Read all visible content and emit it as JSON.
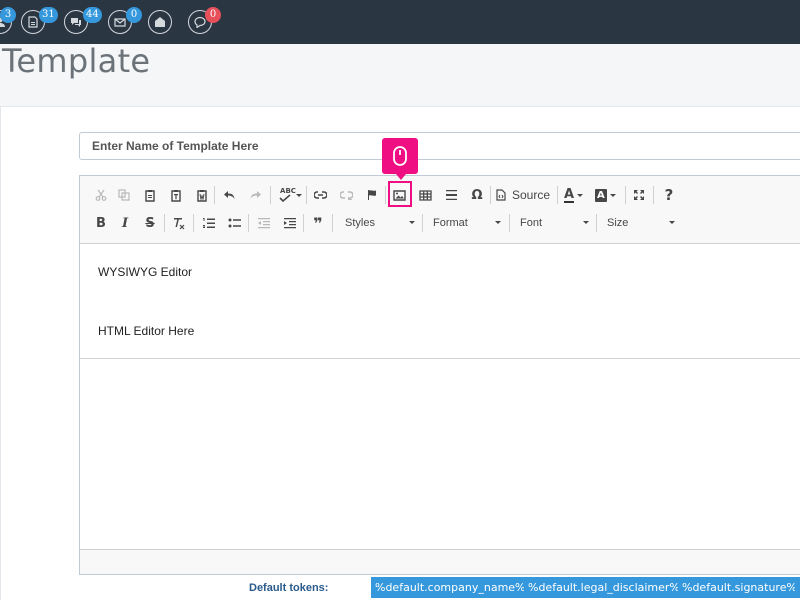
{
  "colors": {
    "topbar": "#2b3643",
    "badge_blue": "#3598dc",
    "badge_red": "#e7505a",
    "highlight": "#ef0f83",
    "token_bg": "#3598dc"
  },
  "topbar": {
    "items": [
      {
        "icon": "user-icon",
        "badge": "3"
      },
      {
        "icon": "document-icon",
        "badge": "31"
      },
      {
        "icon": "chat-icon",
        "badge": "44"
      },
      {
        "icon": "envelope-icon",
        "badge": "0"
      },
      {
        "icon": "open-envelope-icon",
        "badge": ""
      },
      {
        "icon": "comment-icon",
        "badge": "0"
      }
    ]
  },
  "page": {
    "title": "Template"
  },
  "form": {
    "name_placeholder": "Enter Name of Template Here"
  },
  "editor": {
    "toolbar": {
      "source_label": "Source",
      "styles_label": "Styles",
      "format_label": "Format",
      "font_label": "Font",
      "size_label": "Size",
      "help_label": "?",
      "omega_label": "Ω",
      "bold_label": "B",
      "italic_label": "I",
      "strike_label": "S",
      "quote_label": "❞",
      "spell_label": "ABC",
      "text_color_label": "A",
      "bg_color_label": "A"
    },
    "content": {
      "line1": "WYSIWYG Editor",
      "line2": "HTML Editor Here"
    }
  },
  "highlight": {
    "icon": "mouse-icon",
    "target": "image-button"
  },
  "tokens": {
    "label": "Default tokens:",
    "items": [
      "%default.company_name%",
      "%default.legal_disclaimer%",
      "%default.signature%"
    ]
  }
}
